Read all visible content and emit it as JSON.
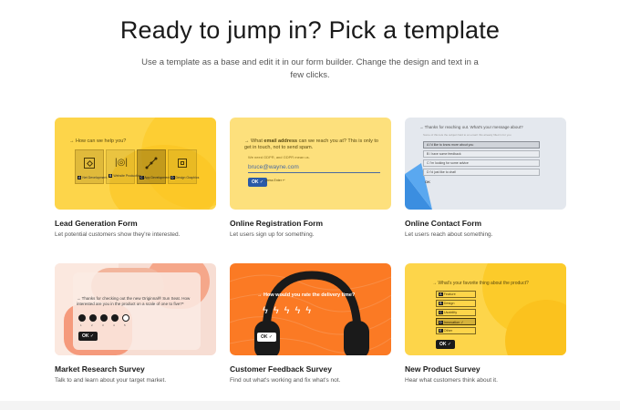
{
  "header": {
    "title": "Ready to jump in? Pick a template",
    "subtitle": "Use a template as a base and edit it in our form builder. Change the design and text in a few clicks."
  },
  "cards": [
    {
      "title": "Lead Generation Form",
      "desc": "Let potential customers show they're interested.",
      "preview": {
        "question": "→ How can we help you?",
        "options": [
          "Net Development",
          "Website Production",
          "App Development",
          "Design Graphics"
        ],
        "option_keys": [
          "A",
          "B",
          "C",
          "D"
        ]
      }
    },
    {
      "title": "Online Registration Form",
      "desc": "Let users sign up for something.",
      "preview": {
        "question_pre": "→ What ",
        "question_bold": "email address",
        "question_post": " can we reach you at? This is only to get in touch, not to send spam.",
        "hint": "We need GDPR, and GDPR mean us.",
        "email": "bruce@wayne.com",
        "ok": "OK ✓",
        "press": "press Enter ↵"
      }
    },
    {
      "title": "Online Contact Form",
      "desc": "Let users reach about something.",
      "preview": {
        "question": "→ Thanks for reaching out. What's your message about?",
        "hint": "Some of this lets the subject field to an email: this already filled in for you",
        "options": [
          "I'd like to know more about you",
          "I have some feedback",
          "I'm looking for some advice",
          "I'd just like to chat!"
        ],
        "option_keys": [
          "A",
          "B",
          "C",
          "D"
        ],
        "ok": "OK"
      }
    },
    {
      "title": "Market Research Survey",
      "desc": "Talk to and learn about your target market.",
      "preview": {
        "question": "→ Thanks for checking out the new Originnal® Sun Seat. How interested are you in the product on a scale of one to five?*",
        "scale": [
          "1",
          "2",
          "3",
          "4",
          "5"
        ],
        "ok": "OK ✓"
      }
    },
    {
      "title": "Customer Feedback Survey",
      "desc": "Find out what's working and fix what's not.",
      "preview": {
        "question": "→ How would you rate the delivery time?",
        "ok": "OK ✓"
      }
    },
    {
      "title": "New Product Survey",
      "desc": "Hear what customers think about it.",
      "preview": {
        "question": "→ What's your favorite thing about the product?",
        "options": [
          "Feature",
          "Design",
          "Usability",
          "Innovation",
          "Other"
        ],
        "option_keys": [
          "A",
          "B",
          "C",
          "D",
          "E"
        ],
        "ok": "OK ✓"
      }
    }
  ],
  "colors": {
    "yellow": "#fdd54a",
    "yellow_light": "#fde07c",
    "gray_blue": "#e4e8ee",
    "blue": "#3b8ee0",
    "peach": "#f7ddd3",
    "orange": "#fb7a24",
    "dark": "#1a1a1a"
  }
}
